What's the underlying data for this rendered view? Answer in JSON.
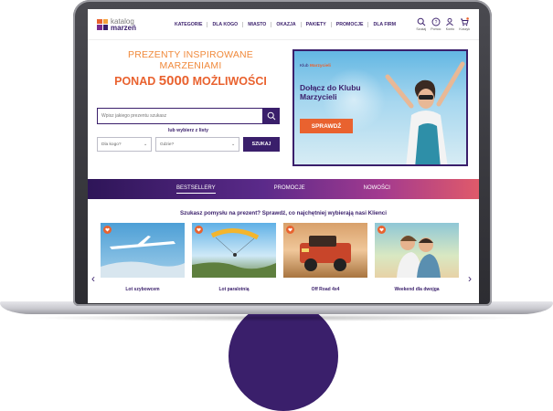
{
  "header": {
    "logo_top": "katalog",
    "logo_bottom": "marzeń",
    "nav": [
      "KATEGORIE",
      "DLA KOGO",
      "MIASTO",
      "OKAZJA",
      "PAKIETY",
      "PROMOCJE",
      "DLA FIRM"
    ],
    "icons": [
      {
        "name": "search-icon",
        "label": "Szukaj"
      },
      {
        "name": "info-icon",
        "label": "Pomoc"
      },
      {
        "name": "user-icon",
        "label": "Konto"
      },
      {
        "name": "cart-icon",
        "label": "Koszyk"
      }
    ]
  },
  "hero": {
    "line1": "PREZENTY INSPIROWANE",
    "line2": "MARZENIAMI",
    "line3_prefix": "PONAD",
    "line3_number": "5000",
    "line3_suffix": "MOŻLIWOŚCI",
    "search_placeholder": "Wpisz jakiego prezentu szukasz",
    "or_text": "lub wybierz z listy",
    "select1_value": "Dla kogo?",
    "select2_value": "Gdzie?",
    "search_button": "SZUKAJ"
  },
  "promo": {
    "logo_text_prefix": "Klub",
    "logo_text_brand": "Marzycieli",
    "title": "Dołącz do Klubu Marzycieli",
    "button": "SPRAWDŹ"
  },
  "tabs": [
    {
      "label": "BESTSELLERY",
      "active": true
    },
    {
      "label": "PROMOCJE",
      "active": false
    },
    {
      "label": "NOWOŚCI",
      "active": false
    }
  ],
  "question": "Szukasz pomysłu na prezent? Sprawdź, co najchętniej wybierają nasi Klienci",
  "products": [
    {
      "name": "Lot szybowcem"
    },
    {
      "name": "Lot paralotnią"
    },
    {
      "name": "Off Road 4x4"
    },
    {
      "name": "Weekend dla dwojga"
    }
  ],
  "colors": {
    "brand_purple": "#3a1f6b",
    "brand_orange": "#e9622f"
  }
}
